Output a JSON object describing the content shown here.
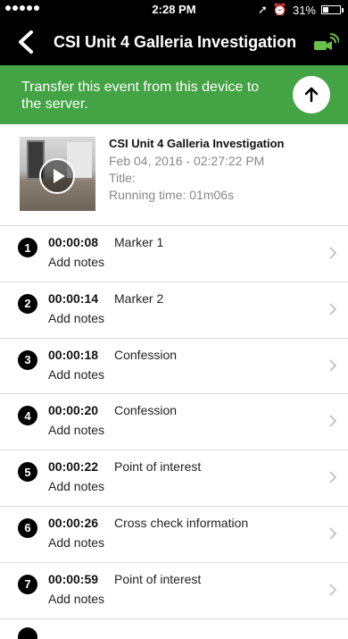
{
  "status_bar": {
    "time": "2:28 PM",
    "battery": "31%"
  },
  "header": {
    "title": "CSI Unit 4 Galleria Investigation"
  },
  "banner": {
    "text": "Transfer this event from this device to the server."
  },
  "event": {
    "title": "CSI Unit 4 Galleria Investigation",
    "date": "Feb 04, 2016 - 02:27:22 PM",
    "title_label": "Title:",
    "running_time": "Running time: 01m06s"
  },
  "markers": [
    {
      "num": "1",
      "time": "00:00:08",
      "label": "Marker 1",
      "notes": "Add notes"
    },
    {
      "num": "2",
      "time": "00:00:14",
      "label": "Marker 2",
      "notes": "Add notes"
    },
    {
      "num": "3",
      "time": "00:00:18",
      "label": "Confession",
      "notes": "Add notes"
    },
    {
      "num": "4",
      "time": "00:00:20",
      "label": "Confession",
      "notes": "Add notes"
    },
    {
      "num": "5",
      "time": "00:00:22",
      "label": "Point of interest",
      "notes": "Add notes"
    },
    {
      "num": "6",
      "time": "00:00:26",
      "label": "Cross check information",
      "notes": "Add notes"
    },
    {
      "num": "7",
      "time": "00:00:59",
      "label": "Point of interest",
      "notes": "Add notes"
    }
  ],
  "colors": {
    "banner": "#44a344",
    "header": "#000000",
    "camera_icon": "#6cc04a"
  }
}
